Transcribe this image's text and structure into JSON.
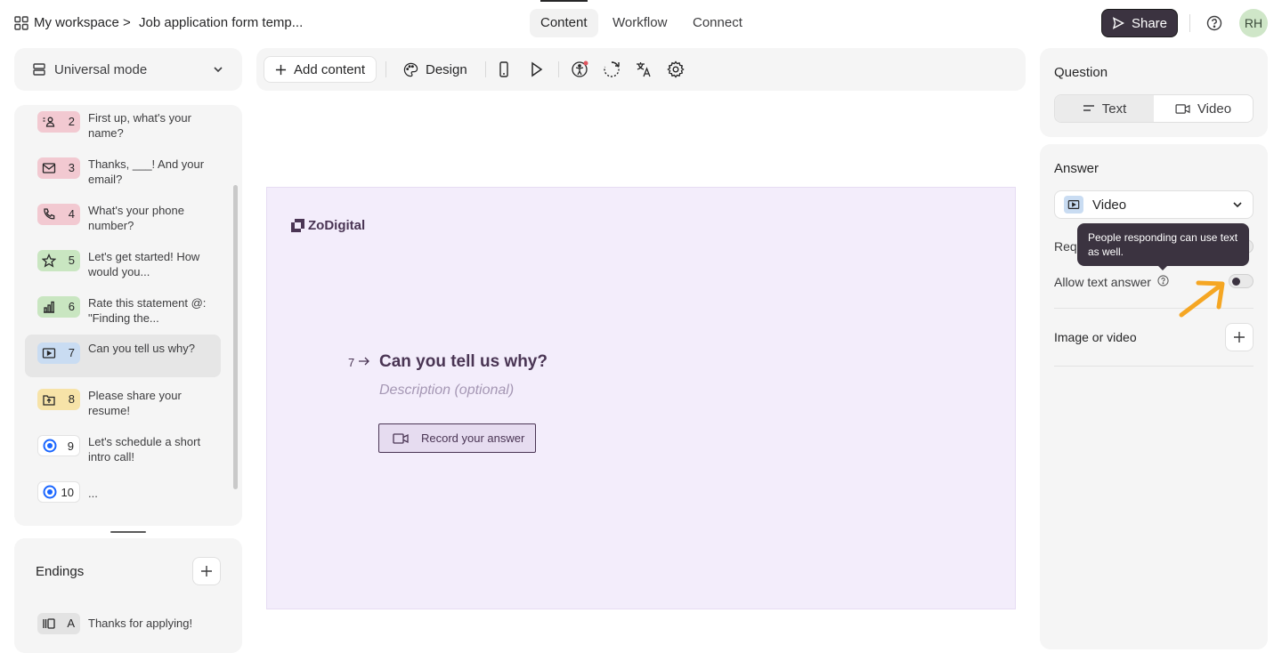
{
  "header": {
    "breadcrumb_root": "My workspace",
    "breadcrumb_separator": ">",
    "breadcrumb_current": "Job application form temp...",
    "tabs": [
      {
        "label": "Content",
        "active": true
      },
      {
        "label": "Workflow",
        "active": false
      },
      {
        "label": "Connect",
        "active": false
      }
    ],
    "share_label": "Share",
    "avatar_initials": "RH"
  },
  "sidebar": {
    "mode_label": "Universal mode",
    "questions": [
      {
        "num": "2",
        "icon": "contact-icon",
        "color": "#f2c9d1",
        "text": "First up, what's your name?"
      },
      {
        "num": "3",
        "icon": "mail-icon",
        "color": "#f2c9d1",
        "text": "Thanks, ___! And your email?"
      },
      {
        "num": "4",
        "icon": "phone-icon",
        "color": "#f2c9d1",
        "text": "What's your phone number?"
      },
      {
        "num": "5",
        "icon": "star-icon",
        "color": "#c9e6c1",
        "text": "Let's get started! How would you..."
      },
      {
        "num": "6",
        "icon": "bar-chart-icon",
        "color": "#c9e6c1",
        "text": "Rate this statement @: \"Finding the..."
      },
      {
        "num": "7",
        "icon": "video-icon",
        "color": "#c9dcf2",
        "text": "Can you tell us why?",
        "selected": true
      },
      {
        "num": "8",
        "icon": "upload-icon",
        "color": "#f7e3a8",
        "text": "Please share your resume!"
      },
      {
        "num": "9",
        "icon": "calendly-icon",
        "color": "#ffffff",
        "text": "Let's schedule a short intro call!"
      },
      {
        "num": "10",
        "icon": "calendly-icon",
        "color": "#ffffff",
        "text": "..."
      }
    ],
    "endings_title": "Endings",
    "endings": [
      {
        "letter": "A",
        "icon": "ending-icon",
        "text": "Thanks for applying!"
      }
    ]
  },
  "toolbar": {
    "add_content_label": "Add content",
    "design_label": "Design"
  },
  "canvas": {
    "brand": "ZoDigital",
    "question_number": "7",
    "question_title": "Can you tell us why?",
    "description_placeholder": "Description (optional)",
    "record_label": "Record your answer"
  },
  "right_panel": {
    "question_title": "Question",
    "question_types": [
      {
        "label": "Text",
        "active": true
      },
      {
        "label": "Video",
        "active": false
      }
    ],
    "answer_title": "Answer",
    "answer_type": "Video",
    "required_label": "Req",
    "allow_text_label": "Allow text answer",
    "allow_text_enabled": false,
    "tooltip": "People responding can use text as well.",
    "image_video_label": "Image or video"
  },
  "colors": {
    "accent_dark": "#3b3340",
    "canvas_bg": "#f3edfb",
    "brand_purple": "#4a3554",
    "annotation_arrow": "#f5a623"
  }
}
